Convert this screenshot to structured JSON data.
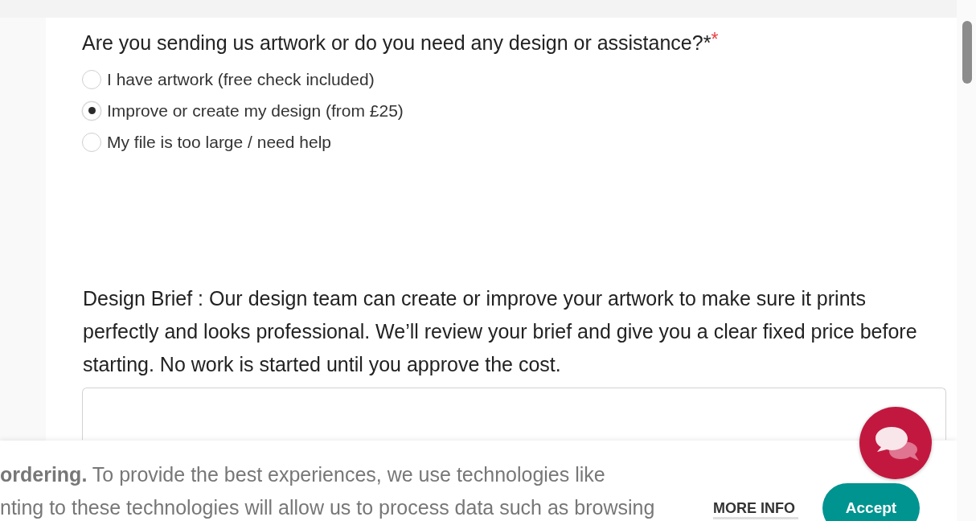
{
  "question": {
    "label": "Are you sending us artwork or do you need any design or assistance?*",
    "required_mark": "*"
  },
  "options": [
    {
      "label": "I have artwork (free check included)",
      "selected": false
    },
    {
      "label": "Improve or create my design (from £25)",
      "selected": true
    },
    {
      "label": "My file is too large / need help",
      "selected": false
    }
  ],
  "design_brief": {
    "label": "Design Brief : Our design team can create or improve your artwork to make sure it prints perfectly and looks professional. We’ll review your brief and give you a clear fixed price before starting. No work is started until you approve the cost."
  },
  "cookie_banner": {
    "lines": [
      "**ordering.** To provide the best experiences, we use technologies like",
      "nting to these technologies will allow us to process data such as browsing"
    ],
    "more_info": "MORE INFO",
    "accept": "Accept"
  }
}
